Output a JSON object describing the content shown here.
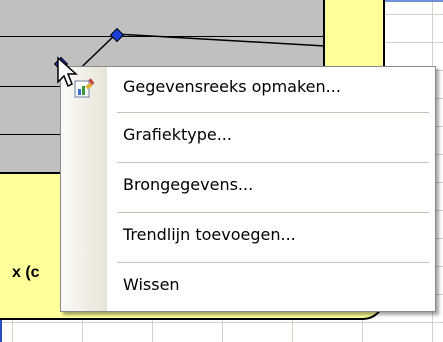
{
  "chart": {
    "axis_label_fragment": "x (c"
  },
  "context_menu": {
    "items": [
      {
        "label": "Gegevensreeks opmaken...",
        "icon": "format-series-icon"
      },
      {
        "label": "Grafiektype..."
      },
      {
        "label": "Brongegevens..."
      },
      {
        "label": "Trendlijn toevoegen..."
      },
      {
        "label": "Wissen"
      }
    ]
  },
  "colors": {
    "chart_area": "#ffff99",
    "plot_area": "#c0c0c0",
    "marker": "#1a3fd9"
  }
}
